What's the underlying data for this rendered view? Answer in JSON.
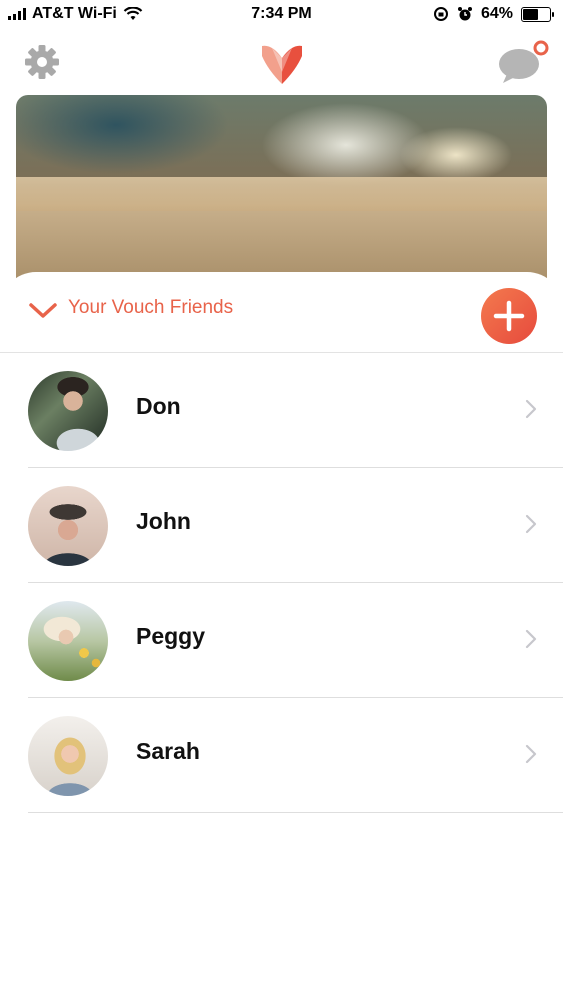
{
  "status_bar": {
    "carrier": "AT&T Wi-Fi",
    "time": "7:34 PM",
    "battery_percent": "64%",
    "battery_level": 0.64
  },
  "top_bar": {
    "settings_icon": "gear-icon",
    "logo_icon": "vouch-heart-logo",
    "chat_icon": "chat-bubble-icon"
  },
  "friends_section": {
    "title": "Your Vouch Friends",
    "add_button_icon": "plus-icon",
    "friends": [
      {
        "name": "Don"
      },
      {
        "name": "John"
      },
      {
        "name": "Peggy"
      },
      {
        "name": "Sarah"
      }
    ]
  },
  "colors": {
    "accent": "#e8634a",
    "add_button_start": "#f47a4e",
    "add_button_end": "#e64a3d",
    "divider": "#dedede"
  }
}
